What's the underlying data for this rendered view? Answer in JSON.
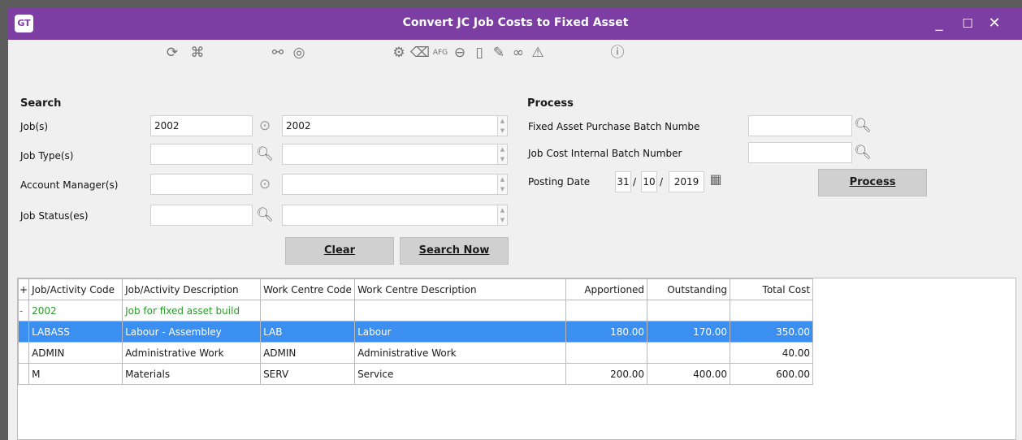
{
  "window": {
    "logo": "GT",
    "title": "Convert JC Job Costs to Fixed Asset",
    "minimize": "_",
    "maximize": "☐",
    "close": "✕"
  },
  "toolbar": {
    "icons": [
      "refresh-icon",
      "hierarchy-icon",
      "binoculars-icon",
      "compass-icon",
      "settings-icon",
      "tag-icon",
      "afg-icon",
      "back-arrow-icon",
      "notes-icon",
      "attachment-icon",
      "link-icon",
      "alert-icon",
      "help-icon"
    ],
    "afg_label": "AFG"
  },
  "search": {
    "title": "Search",
    "job_label": "Job(s)",
    "job_from": "2002",
    "job_to": "2002",
    "job_type_label": "Job Type(s)",
    "job_type_from": "",
    "job_type_to": "",
    "account_manager_label": "Account Manager(s)",
    "account_manager_from": "",
    "account_manager_to": "",
    "job_status_label": "Job Status(es)",
    "job_status_from": "",
    "job_status_to": "",
    "clear_label": "Clear",
    "search_now_label": "Search Now"
  },
  "process": {
    "title": "Process",
    "fa_batch_label": "Fixed Asset Purchase Batch Numbe",
    "fa_batch_value": "",
    "jc_batch_label": "Job Cost Internal Batch Number",
    "jc_batch_value": "",
    "posting_date_label": "Posting Date",
    "posting_day": "31",
    "posting_month": "10",
    "posting_year": "2019",
    "date_sep": "/",
    "process_label": "Process"
  },
  "grid": {
    "expand_header": "+",
    "columns": [
      "Job/Activity Code",
      "Job/Activity Description",
      "Work Centre Code",
      "Work Centre Description",
      "Apportioned",
      "Outstanding",
      "Total Cost"
    ],
    "rows": [
      {
        "marker": "-",
        "code": "2002",
        "description": "Job for fixed asset build",
        "wc_code": "",
        "wc_description": "",
        "apportioned": "",
        "outstanding": "",
        "total": ""
      },
      {
        "marker": "",
        "code": "LABASS",
        "description": "Labour - Assembley",
        "wc_code": "LAB",
        "wc_description": "Labour",
        "apportioned": "180.00",
        "outstanding": "170.00",
        "total": "350.00"
      },
      {
        "marker": "",
        "code": "ADMIN",
        "description": "Administrative Work",
        "wc_code": "ADMIN",
        "wc_description": "Administrative Work",
        "apportioned": "",
        "outstanding": "",
        "total": "40.00"
      },
      {
        "marker": "",
        "code": "M",
        "description": "Materials",
        "wc_code": "SERV",
        "wc_description": "Service",
        "apportioned": "200.00",
        "outstanding": "400.00",
        "total": "600.00"
      }
    ]
  }
}
